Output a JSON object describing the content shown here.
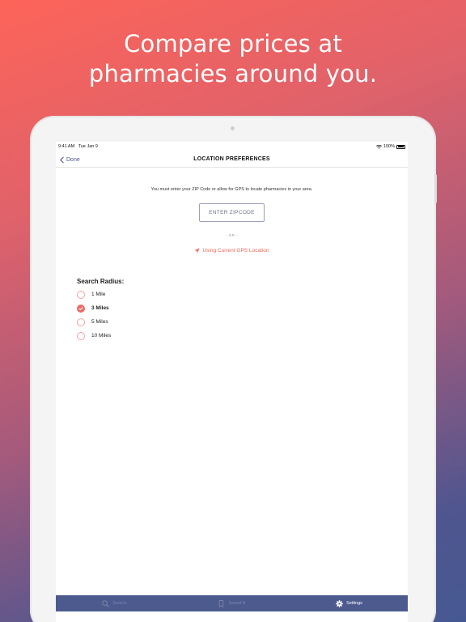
{
  "headline": {
    "line1": "Compare prices at",
    "line2": "pharmacies around you."
  },
  "status_bar": {
    "time": "9:41 AM",
    "date": "Tue Jan 9",
    "battery": "100%"
  },
  "nav": {
    "back_label": "Done",
    "title": "LOCATION PREFERENCES"
  },
  "content": {
    "instruction": "You must enter your ZIP Code or allow for GPS to locate pharmacies in your area.",
    "zip_placeholder": "ENTER ZIPCODE",
    "or_text": "- OR -",
    "gps_label": "Using Current GPS Location"
  },
  "radius": {
    "title": "Search Radius:",
    "options": [
      {
        "label": "1 Mile",
        "selected": false
      },
      {
        "label": "3 Miles",
        "selected": true
      },
      {
        "label": "5 Miles",
        "selected": false
      },
      {
        "label": "10 Miles",
        "selected": false
      }
    ]
  },
  "tabs": [
    {
      "label": "Search",
      "icon": "search-icon",
      "active": false
    },
    {
      "label": "Saved R",
      "icon": "bookmark-icon",
      "active": false
    },
    {
      "label": "Settings",
      "icon": "gear-icon",
      "active": true
    }
  ],
  "colors": {
    "accent": "#ee6a66",
    "nav_blue": "#4c5a8e"
  }
}
